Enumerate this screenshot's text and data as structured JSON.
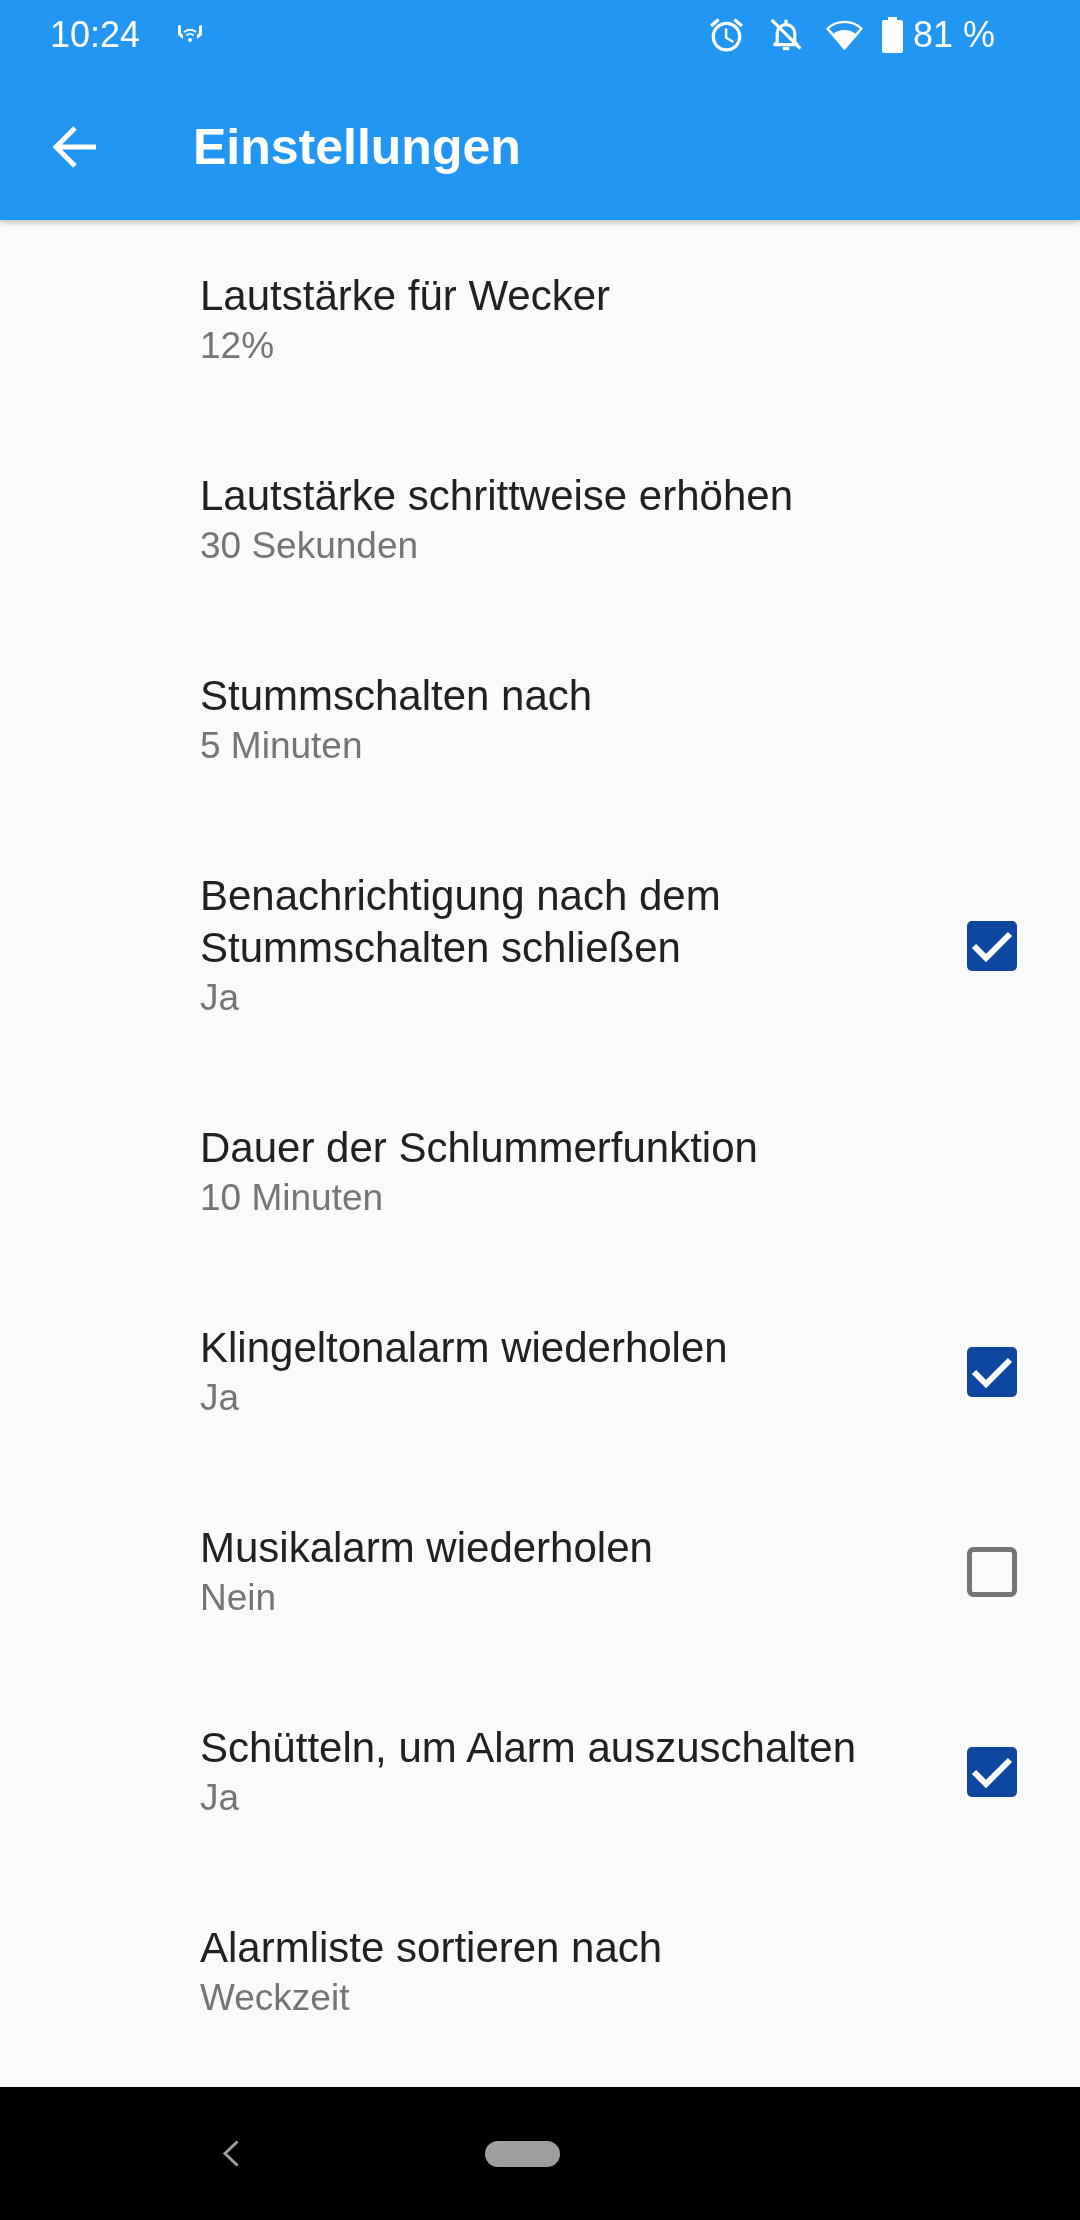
{
  "status_bar": {
    "time": "10:24",
    "battery": "81 %"
  },
  "app_bar": {
    "title": "Einstellungen"
  },
  "settings": [
    {
      "kind": "value",
      "title": "Lautstärke für Wecker",
      "summary": "12%"
    },
    {
      "kind": "value",
      "title": "Lautstärke schrittweise erhöhen",
      "summary": "30 Sekunden"
    },
    {
      "kind": "value",
      "title": "Stummschalten nach",
      "summary": "5 Minuten"
    },
    {
      "kind": "checkbox",
      "title": "Benachrichtigung nach dem Stummschalten schließen",
      "summary": "Ja",
      "checked": true
    },
    {
      "kind": "value",
      "title": "Dauer der Schlummerfunktion",
      "summary": "10 Minuten"
    },
    {
      "kind": "checkbox",
      "title": "Klingeltonalarm wiederholen",
      "summary": "Ja",
      "checked": true
    },
    {
      "kind": "checkbox",
      "title": "Musikalarm wiederholen",
      "summary": "Nein",
      "checked": false
    },
    {
      "kind": "checkbox",
      "title": "Schütteln, um Alarm auszuschalten",
      "summary": "Ja",
      "checked": true
    },
    {
      "kind": "value",
      "title": "Alarmliste sortieren nach",
      "summary": "Weckzeit"
    }
  ]
}
